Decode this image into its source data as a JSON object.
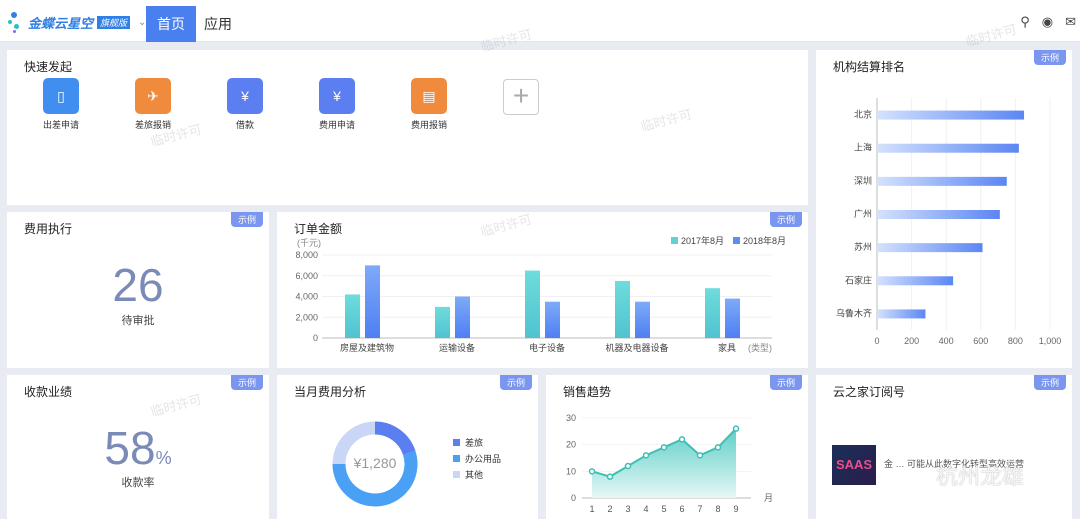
{
  "header": {
    "brand": "金蝶云星空",
    "edition": "旗舰版",
    "tabs": [
      "首页",
      "应用"
    ]
  },
  "quick": {
    "title": "快速发起",
    "items": [
      {
        "label": "出差申请",
        "icon": "suitcase-icon",
        "color": "#3f8ef0"
      },
      {
        "label": "差旅报销",
        "icon": "plane-ticket-icon",
        "color": "#f08a3c"
      },
      {
        "label": "借款",
        "icon": "money-icon",
        "color": "#5b7ef0"
      },
      {
        "label": "费用申请",
        "icon": "envelope-yen-icon",
        "color": "#5b7ef0"
      },
      {
        "label": "费用报销",
        "icon": "document-icon",
        "color": "#f08a3c"
      }
    ]
  },
  "tag": "示例",
  "expense": {
    "title": "费用执行",
    "value": "26",
    "label": "待审批"
  },
  "collect": {
    "title": "收款业绩",
    "value": "58",
    "unit": "%",
    "label": "收款率"
  },
  "monthly": {
    "title": "当月费用分析",
    "center": "¥1,280",
    "legend": [
      "差旅",
      "办公用品",
      "其他"
    ]
  },
  "subscribe": {
    "title": "云之家订阅号",
    "thumb": "SAAS",
    "text": "金 … 可能从此数字化转型高效运营",
    "watermark": "杭州龙雄"
  },
  "watermark": "临时许可",
  "chart_data": [
    {
      "type": "bar",
      "title": "订单金额",
      "ylabel": "(千元)",
      "xlabel": "(类型)",
      "categories": [
        "房屋及建筑物",
        "运输设备",
        "电子设备",
        "机器及电器设备",
        "家具"
      ],
      "series": [
        {
          "name": "2017年8月",
          "color": "#5fd2d4",
          "values": [
            4200,
            3000,
            6500,
            5500,
            4800
          ]
        },
        {
          "name": "2018年8月",
          "color": "#5b8ef5",
          "values": [
            7000,
            4000,
            3500,
            3500,
            3800
          ]
        }
      ],
      "ylim": [
        0,
        8000
      ],
      "yticks": [
        "0",
        "2,000",
        "4,000",
        "6,000",
        "8,000"
      ]
    },
    {
      "type": "bar",
      "orientation": "horizontal",
      "title": "机构结算排名",
      "categories": [
        "北京",
        "上海",
        "深圳",
        "广州",
        "苏州",
        "石家庄",
        "乌鲁木齐"
      ],
      "values": [
        850,
        820,
        750,
        710,
        610,
        440,
        280
      ],
      "xlim": [
        0,
        1000
      ],
      "xticks": [
        "0",
        "200",
        "400",
        "600",
        "800",
        "1,000"
      ]
    },
    {
      "type": "area",
      "title": "销售趋势",
      "x": [
        1,
        2,
        3,
        4,
        5,
        6,
        7,
        8,
        9
      ],
      "values": [
        10,
        8,
        12,
        16,
        19,
        22,
        16,
        19,
        26
      ],
      "ylim": [
        0,
        30
      ],
      "yticks": [
        "0",
        "10",
        "20",
        "30"
      ],
      "xlabel": "月"
    },
    {
      "type": "pie",
      "title": "当月费用分析",
      "labels": [
        "差旅",
        "办公用品",
        "其他"
      ],
      "values": [
        20,
        55,
        25
      ],
      "colors": [
        "#5b7ef0",
        "#4aa0f5",
        "#c9d6f6"
      ]
    }
  ]
}
